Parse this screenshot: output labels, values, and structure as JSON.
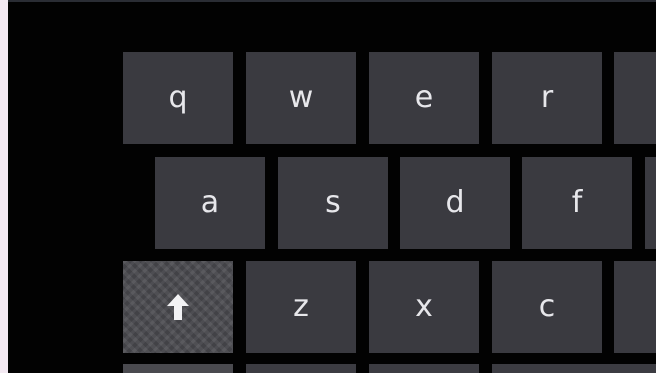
{
  "keyboard": {
    "row1": [
      "q",
      "w",
      "e",
      "r",
      ""
    ],
    "row2": [
      "a",
      "s",
      "d",
      "f",
      ""
    ],
    "row3": {
      "shift_icon": "shift-arrow-up-icon",
      "keys": [
        "z",
        "x",
        "c",
        ""
      ]
    }
  }
}
